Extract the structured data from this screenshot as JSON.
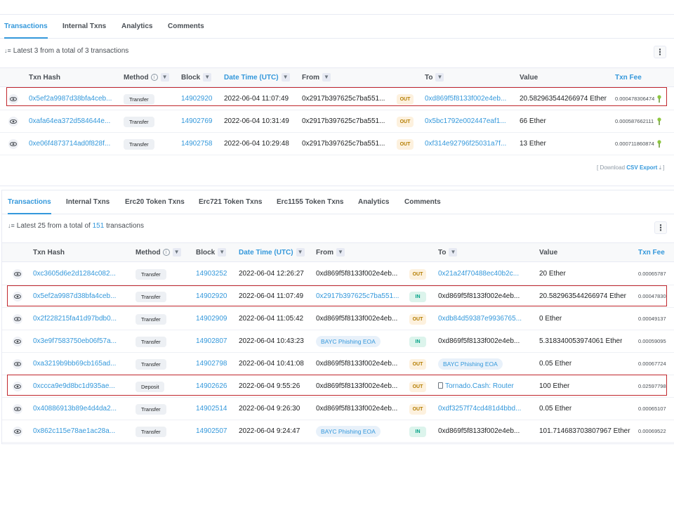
{
  "panel1": {
    "tabs": [
      "Transactions",
      "Internal Txns",
      "Analytics",
      "Comments"
    ],
    "summary": {
      "prefix": "Latest 3 from a total of",
      "count": "3",
      "suffix": "transactions"
    },
    "headers": {
      "txn_hash": "Txn Hash",
      "method": "Method",
      "block": "Block",
      "date": "Date Time (UTC)",
      "from": "From",
      "to": "To",
      "value": "Value",
      "fee": "Txn Fee"
    },
    "rows": [
      {
        "hash": "0x5ef2a9987d38bfa4ceb...",
        "method": "Transfer",
        "block": "14902920",
        "date": "2022-06-04 11:07:49",
        "from": "0x2917b397625c7ba551...",
        "dir": "OUT",
        "to": "0xd869f5f8133f002e4eb...",
        "value": "20.582963544266974 Ether",
        "fee": "0.000478306474"
      },
      {
        "hash": "0xafa64ea372d584644e...",
        "method": "Transfer",
        "block": "14902769",
        "date": "2022-06-04 10:31:49",
        "from": "0x2917b397625c7ba551...",
        "dir": "OUT",
        "to": "0x5bc1792e002447eaf1...",
        "value": "66 Ether",
        "fee": "0.000587662111"
      },
      {
        "hash": "0xe06f4873714ad0f828f...",
        "method": "Transfer",
        "block": "14902758",
        "date": "2022-06-04 10:29:48",
        "from": "0x2917b397625c7ba551...",
        "dir": "OUT",
        "to": "0xf314e92796f25031a7f...",
        "value": "13 Ether",
        "fee": "0.000711860874"
      }
    ],
    "download": {
      "open": "[ Download",
      "csv": "CSV Export",
      "close": "]"
    }
  },
  "panel2": {
    "tabs": [
      "Transactions",
      "Internal Txns",
      "Erc20 Token Txns",
      "Erc721 Token Txns",
      "Erc1155 Token Txns",
      "Analytics",
      "Comments"
    ],
    "summary": {
      "prefix": "Latest 25 from a total of",
      "count": "151",
      "suffix": "transactions"
    },
    "headers": {
      "txn_hash": "Txn Hash",
      "method": "Method",
      "block": "Block",
      "date": "Date Time (UTC)",
      "from": "From",
      "to": "To",
      "value": "Value",
      "fee": "Txn Fee"
    },
    "rows": [
      {
        "hash": "0xc3605d6e2d1284c082...",
        "method": "Transfer",
        "block": "14903252",
        "date": "2022-06-04 12:26:27",
        "from": "0xd869f5f8133f002e4eb...",
        "dir": "OUT",
        "to": "0x21a24f70488ec40b2c...",
        "value": "20 Ether",
        "fee": "0.00065787"
      },
      {
        "hash": "0x5ef2a9987d38bfa4ceb...",
        "method": "Transfer",
        "block": "14902920",
        "date": "2022-06-04 11:07:49",
        "from": "0x2917b397625c7ba551...",
        "dir": "IN",
        "to": "0xd869f5f8133f002e4eb...",
        "value": "20.582963544266974 Ether",
        "fee": "0.00047830"
      },
      {
        "hash": "0x2f228215fa41d97bdb0...",
        "method": "Transfer",
        "block": "14902909",
        "date": "2022-06-04 11:05:42",
        "from": "0xd869f5f8133f002e4eb...",
        "dir": "OUT",
        "to": "0xdb84d59387e9936765...",
        "value": "0 Ether",
        "fee": "0.00049137"
      },
      {
        "hash": "0x3e9f7583750eb06f57a...",
        "method": "Transfer",
        "block": "14902807",
        "date": "2022-06-04 10:43:23",
        "from": "BAYC Phishing EOA",
        "dir": "IN",
        "to": "0xd869f5f8133f002e4eb...",
        "value": "5.318340053974061 Ether",
        "fee": "0.00059095"
      },
      {
        "hash": "0xa3219b9bb69cb165ad...",
        "method": "Transfer",
        "block": "14902798",
        "date": "2022-06-04 10:41:08",
        "from": "0xd869f5f8133f002e4eb...",
        "dir": "OUT",
        "to": "BAYC Phishing EOA",
        "value": "0.05 Ether",
        "fee": "0.00067724"
      },
      {
        "hash": "0xccca9e9d8bc1d935ae...",
        "method": "Deposit",
        "block": "14902626",
        "date": "2022-06-04 9:55:26",
        "from": "0xd869f5f8133f002e4eb...",
        "dir": "OUT",
        "to": "Tornado.Cash: Router",
        "value": "100 Ether",
        "fee": "0.02597798"
      },
      {
        "hash": "0x40886913b89e4d4da2...",
        "method": "Transfer",
        "block": "14902514",
        "date": "2022-06-04 9:26:30",
        "from": "0xd869f5f8133f002e4eb...",
        "dir": "OUT",
        "to": "0xdf3257f74cd481d4bbd...",
        "value": "0.05 Ether",
        "fee": "0.00065107"
      },
      {
        "hash": "0x862c115e78ae1ac28a...",
        "method": "Transfer",
        "block": "14902507",
        "date": "2022-06-04 9:24:47",
        "from": "BAYC Phishing EOA",
        "dir": "IN",
        "to": "0xd869f5f8133f002e4eb...",
        "value": "101.714683703807967 Ether",
        "fee": "0.00069522"
      }
    ]
  },
  "colors": {
    "link": "#3498db",
    "out_badge": "#fdf1de",
    "in_badge": "#dcf4ec",
    "highlight": "#c0272d"
  },
  "icons": [
    "eye-icon",
    "filter-icon",
    "info-icon",
    "sort-icon",
    "more-icon",
    "fee-icon",
    "download-icon",
    "contract-icon"
  ]
}
